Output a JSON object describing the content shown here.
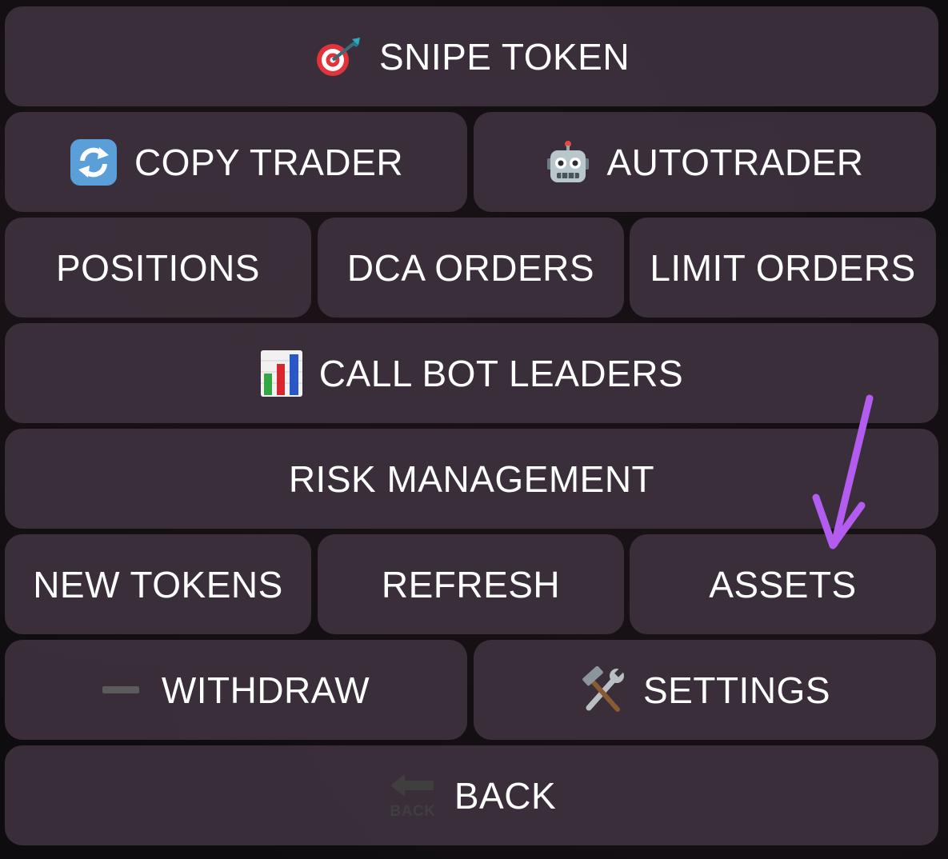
{
  "keyboard": {
    "rows": [
      [
        {
          "label": "SNIPE TOKEN",
          "icon": "dart-target-icon"
        }
      ],
      [
        {
          "label": "COPY TRADER",
          "icon": "refresh-arrows-icon"
        },
        {
          "label": "AUTOTRADER",
          "icon": "robot-icon"
        }
      ],
      [
        {
          "label": "POSITIONS"
        },
        {
          "label": "DCA ORDERS"
        },
        {
          "label": "LIMIT ORDERS"
        }
      ],
      [
        {
          "label": "CALL BOT LEADERS",
          "icon": "bar-chart-icon"
        }
      ],
      [
        {
          "label": "RISK MANAGEMENT"
        }
      ],
      [
        {
          "label": "NEW TOKENS"
        },
        {
          "label": "REFRESH"
        },
        {
          "label": "ASSETS"
        }
      ],
      [
        {
          "label": "WITHDRAW",
          "icon": "minus-icon"
        },
        {
          "label": "SETTINGS",
          "icon": "hammer-wrench-icon"
        }
      ],
      [
        {
          "label": "BACK",
          "icon": "back-arrow-icon",
          "icon_text": "BACK"
        }
      ]
    ]
  },
  "annotation": {
    "type": "arrow",
    "points_to": "ASSETS",
    "color": "#b35cf0"
  }
}
